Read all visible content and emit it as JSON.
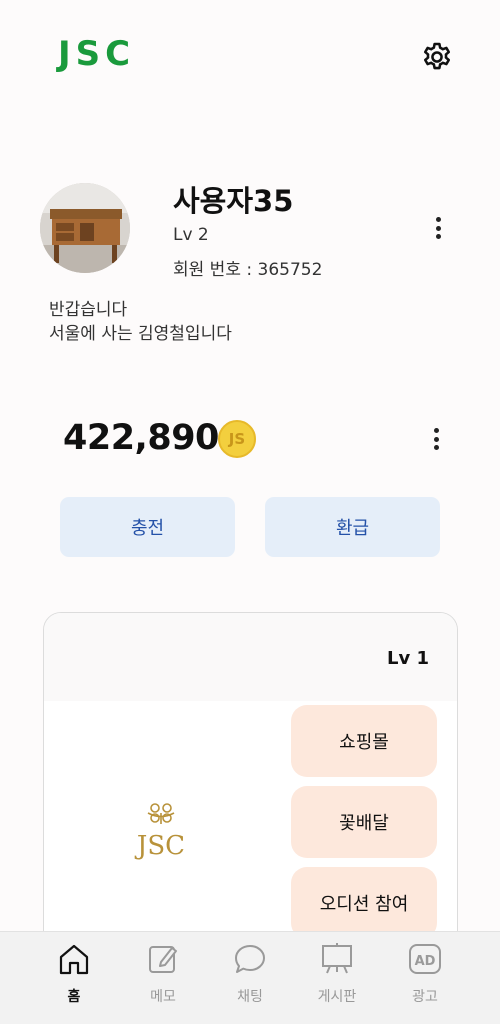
{
  "app": {
    "logo_text": "JSC"
  },
  "profile": {
    "name": "사용자35",
    "level": "Lv 2",
    "member_number": "회원 번호 : 365752",
    "bio_line1": "반갑습니다",
    "bio_line2": "서울에 사는 김영철입니다"
  },
  "wallet": {
    "balance": "422,890",
    "coin_label": "JS",
    "charge_label": "충전",
    "refund_label": "환급"
  },
  "card": {
    "level": "Lv 1",
    "logo_text": "JSC",
    "items": [
      {
        "label": "쇼핑몰"
      },
      {
        "label": "꽃배달"
      },
      {
        "label": "오디션 참여"
      }
    ]
  },
  "nav": {
    "items": [
      {
        "label": "홈",
        "icon": "home-icon",
        "active": true
      },
      {
        "label": "메모",
        "icon": "memo-icon",
        "active": false
      },
      {
        "label": "채팅",
        "icon": "chat-icon",
        "active": false
      },
      {
        "label": "게시판",
        "icon": "board-icon",
        "active": false
      },
      {
        "label": "광고",
        "icon": "ad-icon",
        "active": false
      }
    ]
  },
  "colors": {
    "brand_green": "#1a9a3c",
    "button_bg": "#e5eef9",
    "button_text": "#2451a8",
    "pill_bg": "#fde8dc",
    "coin": "#f3cf3e",
    "gold_logo": "#b8923a"
  }
}
